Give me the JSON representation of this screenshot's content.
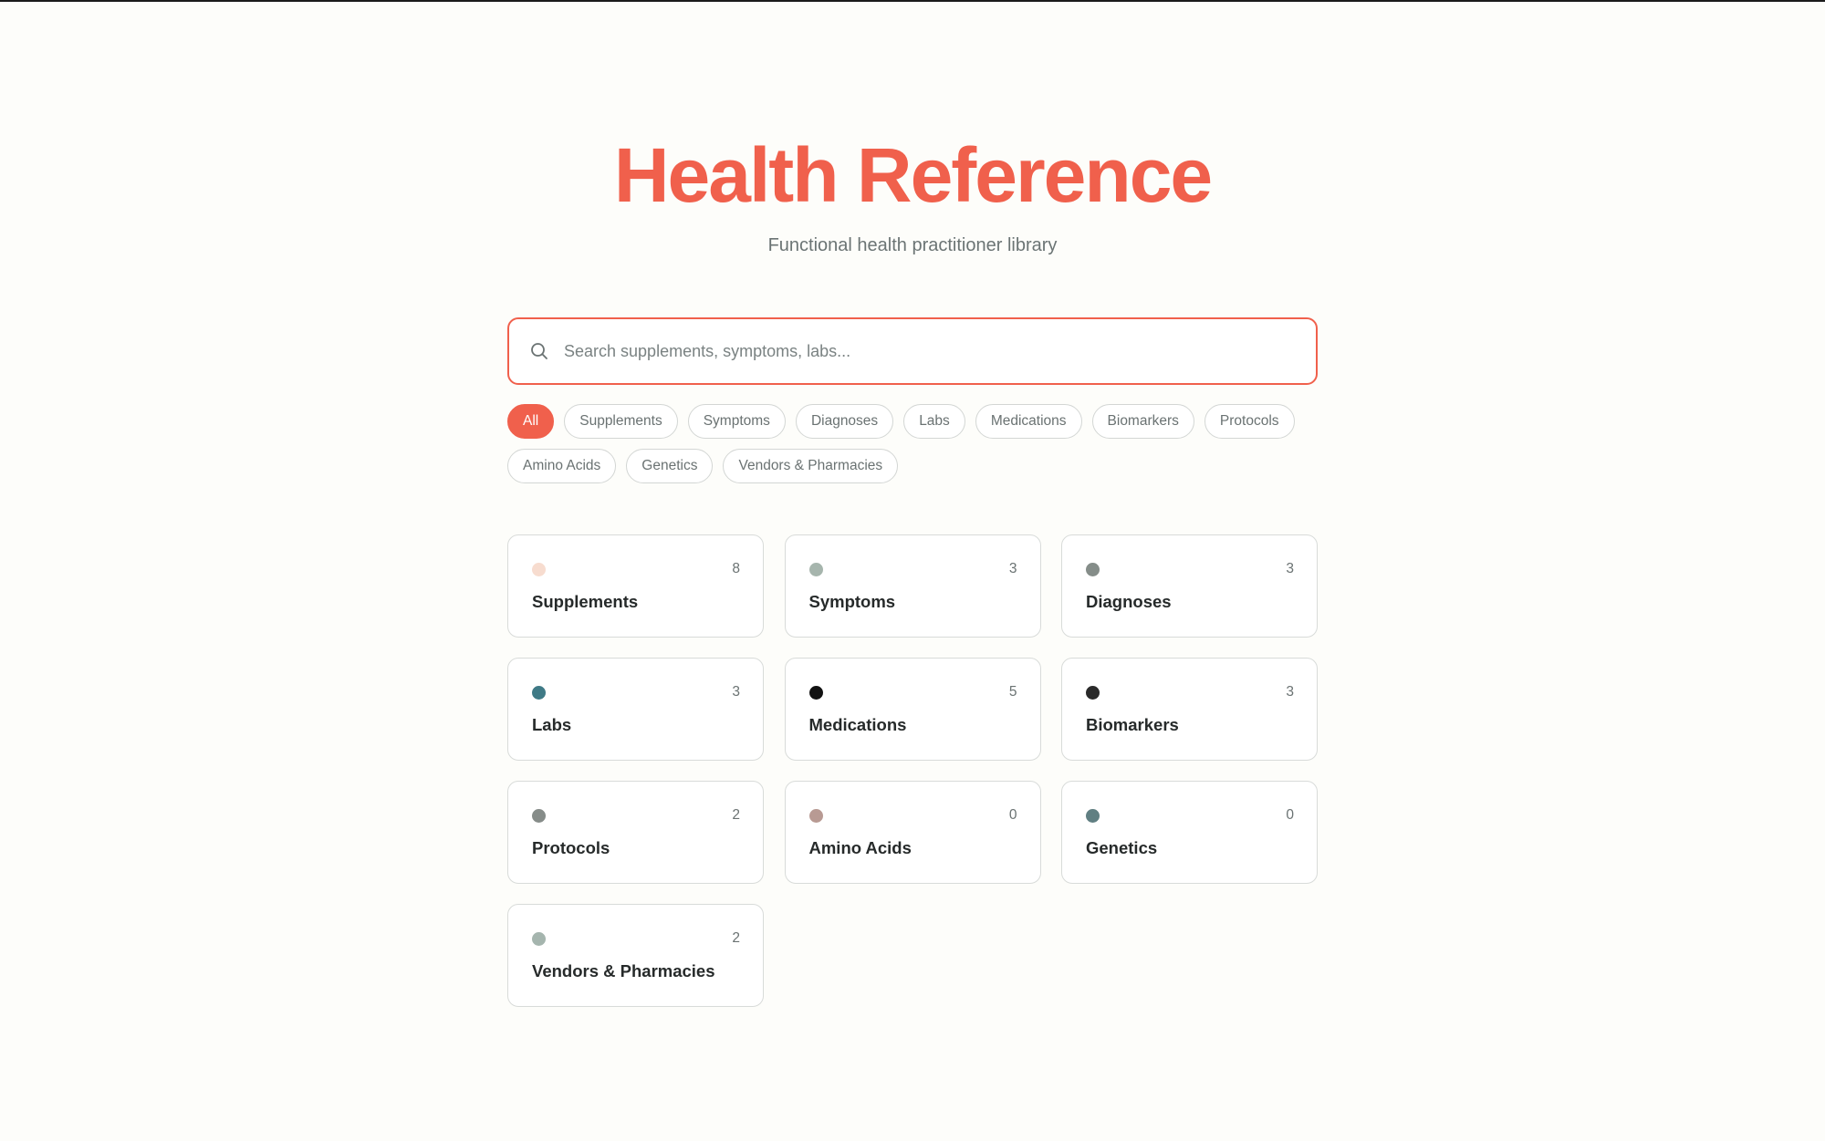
{
  "header": {
    "title": "Health Reference",
    "subtitle": "Functional health practitioner library"
  },
  "search": {
    "placeholder": "Search supplements, symptoms, labs...",
    "value": "",
    "icon": "search-icon"
  },
  "filters": {
    "selected": "All",
    "chips": [
      {
        "label": "All",
        "active": true
      },
      {
        "label": "Supplements",
        "active": false
      },
      {
        "label": "Symptoms",
        "active": false
      },
      {
        "label": "Diagnoses",
        "active": false
      },
      {
        "label": "Labs",
        "active": false
      },
      {
        "label": "Medications",
        "active": false
      },
      {
        "label": "Biomarkers",
        "active": false
      },
      {
        "label": "Protocols",
        "active": false
      },
      {
        "label": "Amino Acids",
        "active": false
      },
      {
        "label": "Genetics",
        "active": false
      },
      {
        "label": "Vendors & Pharmacies",
        "active": false
      }
    ]
  },
  "categories": [
    {
      "label": "Supplements",
      "count": "8",
      "color": "#f7dccf"
    },
    {
      "label": "Symptoms",
      "count": "3",
      "color": "#a6b5ad"
    },
    {
      "label": "Diagnoses",
      "count": "3",
      "color": "#858d89"
    },
    {
      "label": "Labs",
      "count": "3",
      "color": "#3f7a86"
    },
    {
      "label": "Medications",
      "count": "5",
      "color": "#121212"
    },
    {
      "label": "Biomarkers",
      "count": "3",
      "color": "#2a2a2a"
    },
    {
      "label": "Protocols",
      "count": "2",
      "color": "#868c89"
    },
    {
      "label": "Amino Acids",
      "count": "0",
      "color": "#b89a93"
    },
    {
      "label": "Genetics",
      "count": "0",
      "color": "#607f82"
    },
    {
      "label": "Vendors & Pharmacies",
      "count": "2",
      "color": "#a5b5ae"
    }
  ],
  "theme": {
    "accent": "#f0604c",
    "background": "#fdfdfa"
  }
}
